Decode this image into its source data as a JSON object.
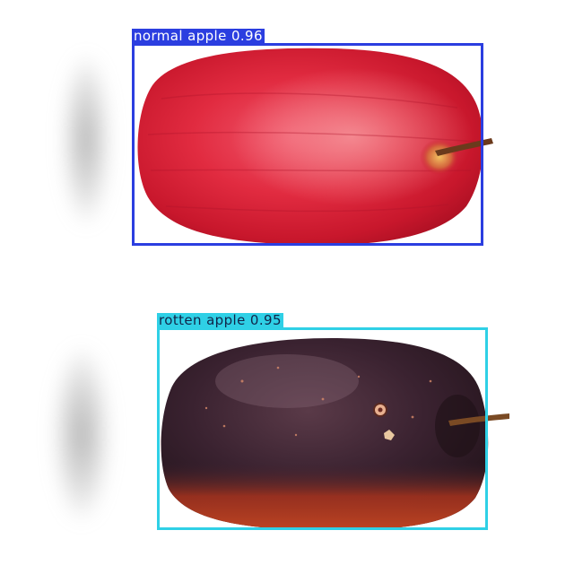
{
  "detections": [
    {
      "label": "normal apple",
      "score": "0.96",
      "color": "#2b3ee0"
    },
    {
      "label": "rotten apple",
      "score": "0.95",
      "color": "#2fd0e6"
    }
  ]
}
